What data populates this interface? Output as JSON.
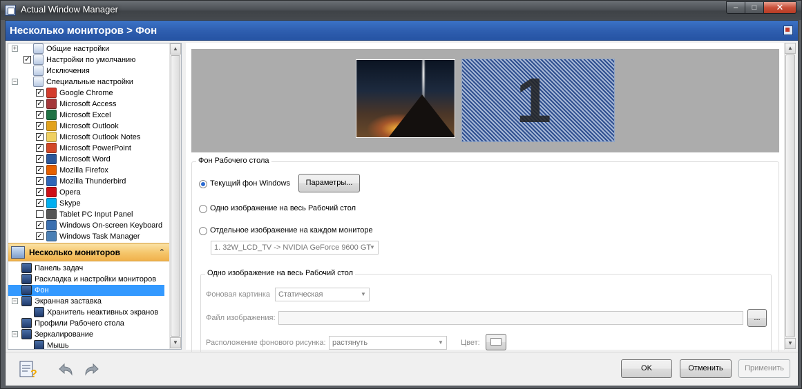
{
  "window": {
    "title": "Actual Window Manager",
    "minimize_label": "–",
    "maximize_label": "□",
    "close_label": "✕"
  },
  "header": {
    "title": "Несколько мониторов > Фон"
  },
  "tree": {
    "top_items": [
      {
        "label": "Общие настройки",
        "expander": "+",
        "checkbox": false
      },
      {
        "label": "Настройки по умолчанию",
        "expander": "",
        "checkbox": true,
        "checked": true
      },
      {
        "label": "Исключения",
        "expander": "",
        "checkbox": false
      },
      {
        "label": "Специальные настройки",
        "expander": "−",
        "checkbox": false
      }
    ],
    "apps": [
      {
        "label": "Google Chrome",
        "checked": true,
        "color": "#d33b2c"
      },
      {
        "label": "Microsoft Access",
        "checked": true,
        "color": "#a4373a"
      },
      {
        "label": "Microsoft Excel",
        "checked": true,
        "color": "#1f7244"
      },
      {
        "label": "Microsoft Outlook",
        "checked": true,
        "color": "#e2a21b"
      },
      {
        "label": "Microsoft Outlook Notes",
        "checked": true,
        "color": "#f0d060"
      },
      {
        "label": "Microsoft PowerPoint",
        "checked": true,
        "color": "#d24726"
      },
      {
        "label": "Microsoft Word",
        "checked": true,
        "color": "#2b579a"
      },
      {
        "label": "Mozilla Firefox",
        "checked": true,
        "color": "#e66000"
      },
      {
        "label": "Mozilla Thunderbird",
        "checked": true,
        "color": "#2f66b8"
      },
      {
        "label": "Opera",
        "checked": true,
        "color": "#cc0f16"
      },
      {
        "label": "Skype",
        "checked": true,
        "color": "#00aff0"
      },
      {
        "label": "Tablet PC Input Panel",
        "checked": false,
        "color": "#555555"
      },
      {
        "label": "Windows On-screen Keyboard",
        "checked": true,
        "color": "#3a6fb0"
      },
      {
        "label": "Windows Task Manager",
        "checked": true,
        "color": "#4a7fb5"
      }
    ],
    "section": {
      "label": "Несколько мониторов",
      "chevron": "⌃"
    },
    "monitor_items": [
      {
        "label": "Панель задач",
        "indent": 1,
        "expander": "",
        "selected": false
      },
      {
        "label": "Раскладка и настройки мониторов",
        "indent": 1,
        "expander": "",
        "selected": false
      },
      {
        "label": "Фон",
        "indent": 1,
        "expander": "",
        "selected": true
      },
      {
        "label": "Экранная заставка",
        "indent": 1,
        "expander": "−",
        "selected": false
      },
      {
        "label": "Хранитель неактивных экранов",
        "indent": 2,
        "expander": "",
        "selected": false
      },
      {
        "label": "Профили Рабочего стола",
        "indent": 1,
        "expander": "",
        "selected": false
      },
      {
        "label": "Зеркалирование",
        "indent": 1,
        "expander": "−",
        "selected": false
      },
      {
        "label": "Мышь",
        "indent": 2,
        "expander": "",
        "selected": false
      }
    ]
  },
  "preview": {
    "monitor2_number": "1"
  },
  "desktop_bg": {
    "legend": "Фон Рабочего стола",
    "option_current": "Текущий фон Windows",
    "params_button": "Параметры...",
    "option_single": "Одно изображение на весь Рабочий стол",
    "option_each": "Отдельное изображение на каждом мониторе",
    "monitor_select": "1. 32W_LCD_TV -> NVIDIA GeForce 9600 GT",
    "selected_option": "current"
  },
  "single_image": {
    "legend": "Одно изображение на весь Рабочий стол",
    "bg_picture_label": "Фоновая картинка",
    "bg_picture_value": "Статическая",
    "file_label": "Файл изображения:",
    "file_value": "",
    "browse_label": "...",
    "position_label": "Расположение фонового рисунка:",
    "position_value": "растянуть",
    "color_label": "Цвет:"
  },
  "footer": {
    "ok": "OK",
    "cancel": "Отменить",
    "apply": "Применить"
  }
}
